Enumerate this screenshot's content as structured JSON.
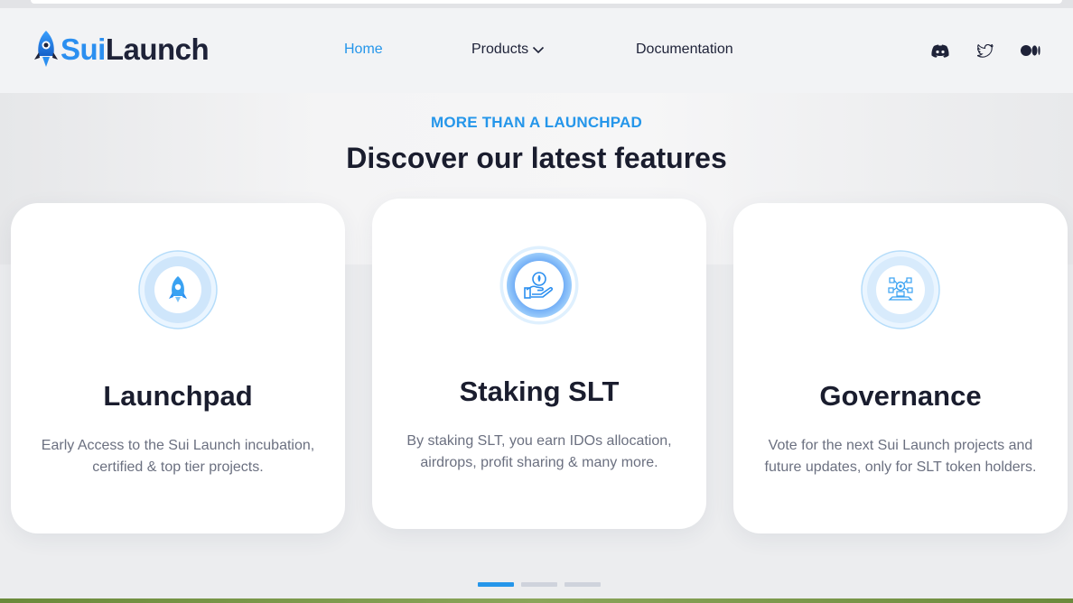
{
  "brand": {
    "part1": "Sui",
    "part2": "Launch"
  },
  "nav": {
    "home": "Home",
    "products": "Products",
    "documentation": "Documentation"
  },
  "social": [
    "discord-icon",
    "twitter-icon",
    "medium-icon"
  ],
  "section": {
    "eyebrow": "MORE THAN A LAUNCHPAD",
    "title": "Discover our latest features"
  },
  "cards": [
    {
      "title": "Launchpad",
      "description": "Early Access to the Sui Launch incubation, certified & top tier projects.",
      "icon": "rocket-icon"
    },
    {
      "title": "Staking SLT",
      "description": "By staking SLT, you earn IDOs allocation, airdrops, profit sharing & many more.",
      "icon": "hand-coin-icon"
    },
    {
      "title": "Governance",
      "description": "Vote for the next Sui Launch projects and future updates, only for SLT token holders.",
      "icon": "governance-icon"
    }
  ],
  "carousel": {
    "pages": 3,
    "active": 1
  },
  "colors": {
    "accent": "#2596ea",
    "text": "#1a1d2e",
    "muted": "#6b7080"
  }
}
